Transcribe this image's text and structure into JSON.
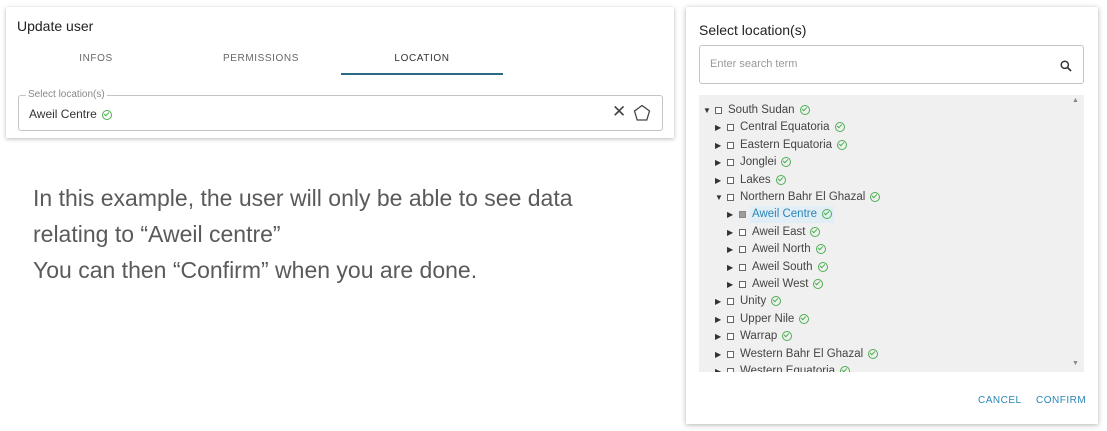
{
  "update_user": {
    "title": "Update user",
    "tabs": [
      {
        "label": "INFOS"
      },
      {
        "label": "PERMISSIONS"
      },
      {
        "label": "LOCATION"
      }
    ],
    "active_tab": "LOCATION",
    "location_field": {
      "legend": "Select location(s)",
      "value": "Aweil Centre"
    }
  },
  "explanation": {
    "lines": [
      "In this example, the user will only be able to see data",
      "relating to “Aweil centre”",
      "You can then “Confirm” when you are done."
    ]
  },
  "dialog": {
    "title": "Select location(s)",
    "search_placeholder": "Enter search term",
    "tree": [
      {
        "label": "South Sudan",
        "level": 0,
        "expanded": true,
        "checked": false,
        "valid": true
      },
      {
        "label": "Central Equatoria",
        "level": 1,
        "expanded": false,
        "checked": false,
        "valid": true
      },
      {
        "label": "Eastern Equatoria",
        "level": 1,
        "expanded": false,
        "checked": false,
        "valid": true
      },
      {
        "label": "Jonglei",
        "level": 1,
        "expanded": false,
        "checked": false,
        "valid": true
      },
      {
        "label": "Lakes",
        "level": 1,
        "expanded": false,
        "checked": false,
        "valid": true
      },
      {
        "label": "Northern Bahr El Ghazal",
        "level": 1,
        "expanded": true,
        "checked": false,
        "valid": true
      },
      {
        "label": "Aweil Centre",
        "level": 2,
        "expanded": false,
        "checked": true,
        "selected": true,
        "valid": true
      },
      {
        "label": "Aweil East",
        "level": 2,
        "expanded": false,
        "checked": false,
        "valid": true
      },
      {
        "label": "Aweil North",
        "level": 2,
        "expanded": false,
        "checked": false,
        "valid": true
      },
      {
        "label": "Aweil South",
        "level": 2,
        "expanded": false,
        "checked": false,
        "valid": true
      },
      {
        "label": "Aweil West",
        "level": 2,
        "expanded": false,
        "checked": false,
        "valid": true
      },
      {
        "label": "Unity",
        "level": 1,
        "expanded": false,
        "checked": false,
        "valid": true
      },
      {
        "label": "Upper Nile",
        "level": 1,
        "expanded": false,
        "checked": false,
        "valid": true
      },
      {
        "label": "Warrap",
        "level": 1,
        "expanded": false,
        "checked": false,
        "valid": true
      },
      {
        "label": "Western Bahr El Ghazal",
        "level": 1,
        "expanded": false,
        "checked": false,
        "valid": true
      },
      {
        "label": "Western Equatoria",
        "level": 1,
        "expanded": false,
        "checked": false,
        "valid": true
      }
    ],
    "cancel_label": "CANCEL",
    "confirm_label": "CONFIRM"
  },
  "colors": {
    "accent": "#2a86b6",
    "tab_underline": "#2b6a84",
    "valid_check": "#4caf50"
  }
}
